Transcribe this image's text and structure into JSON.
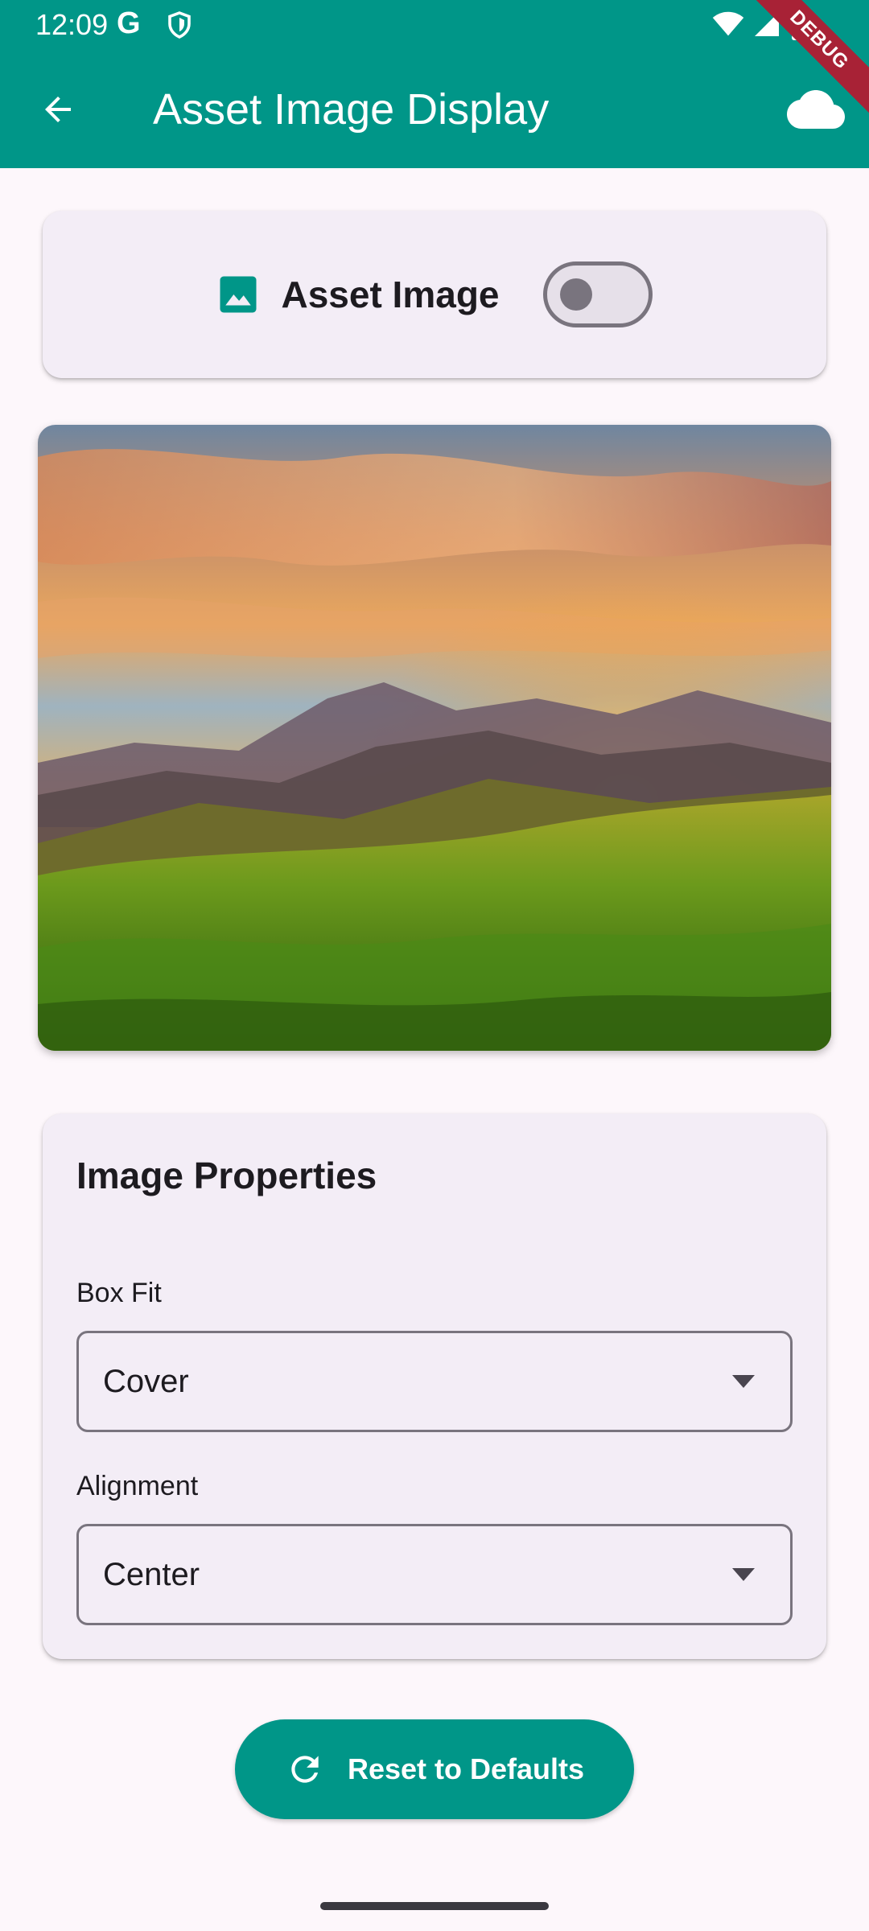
{
  "status_bar": {
    "time": "12:09",
    "g_label": "G"
  },
  "debug_banner": "DEBUG",
  "app_bar": {
    "title": "Asset Image Display",
    "background": "#009688"
  },
  "toggle_card": {
    "label": "Asset Image",
    "switch_on": false
  },
  "image": {
    "description_icon": "landscape-photo"
  },
  "properties": {
    "title": "Image Properties",
    "box_fit": {
      "label": "Box Fit",
      "value": "Cover"
    },
    "alignment": {
      "label": "Alignment",
      "value": "Center"
    }
  },
  "reset_button": {
    "label": "Reset to Defaults"
  },
  "colors": {
    "accent": "#009688",
    "background": "#fdf7fb",
    "card": "#f3edf6"
  }
}
